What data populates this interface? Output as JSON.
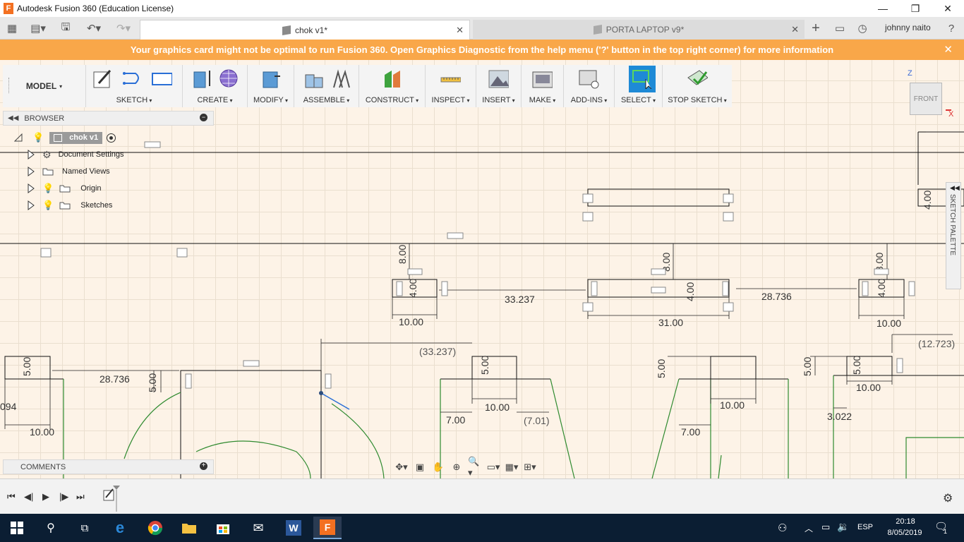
{
  "window": {
    "title": "Autodesk Fusion 360 (Education License)",
    "app_icon_letter": "F"
  },
  "tabs": [
    {
      "label": "chok v1*",
      "active": true
    },
    {
      "label": "PORTA LAPTOP v9*",
      "active": false
    }
  ],
  "user": {
    "name": "johnny naito"
  },
  "banner": {
    "message": "Your graphics card might not be optimal to run Fusion 360. Open Graphics Diagnostic from the help menu ('?' button in the top right corner) for more information",
    "close": "✕"
  },
  "toolbar": {
    "workspace": "MODEL",
    "groups": {
      "sketch": "SKETCH",
      "create": "CREATE",
      "modify": "MODIFY",
      "assemble": "ASSEMBLE",
      "construct": "CONSTRUCT",
      "inspect": "INSPECT",
      "insert": "INSERT",
      "make": "MAKE",
      "addins": "ADD-INS",
      "select": "SELECT",
      "stop_sketch": "STOP SKETCH"
    }
  },
  "viewcube": {
    "face": "FRONT",
    "axis_z": "Z",
    "axis_x": "X"
  },
  "browser": {
    "title": "BROWSER",
    "root": "chok v1",
    "items": [
      {
        "label": "Document Settings"
      },
      {
        "label": "Named Views"
      },
      {
        "label": "Origin"
      },
      {
        "label": "Sketches"
      }
    ]
  },
  "comments": {
    "title": "COMMENTS"
  },
  "sketch_palette": {
    "label": "SKETCH PALETTE"
  },
  "dimensions": {
    "d_33_237": "33.237",
    "d_28_736_top": "28.736",
    "d_10_a": "10.00",
    "d_31": "31.00",
    "d_10_b": "10.00",
    "d_8_a": "8.00",
    "d_8_b": "8.00",
    "d_8_c": "8.00",
    "d_4_a": "4.00",
    "d_4_b": "4.00",
    "d_4_c": "4.00",
    "d_4_d": "4.00",
    "d_ref_33_237": "(33.237)",
    "d_ref_12_723": "(12.723)",
    "d_28_736_low": "28.736",
    "d_5_a": "5.00",
    "d_5_b": "5.00",
    "d_5_c": "5.00",
    "d_5_d": "5.00",
    "d_5_e": "5.00",
    "d_5_f": "5.00",
    "d_094": "094",
    "d_10_c": "10.00",
    "d_10_d": "10.00",
    "d_10_e": "10.00",
    "d_10_f": "10.00",
    "d_7_a": "7.00",
    "d_7_b": "7.00",
    "d_ref_7_01": "(7.01)",
    "d_3_022": "3.022"
  },
  "taskbar": {
    "language": "ESP",
    "time": "20:18",
    "date": "8/05/2019",
    "notifications": "1"
  },
  "colors": {
    "banner": "#f9a749",
    "canvas": "#fdf3e7",
    "select_active": "#1e8ad6",
    "taskbar": "#0b1e33"
  }
}
